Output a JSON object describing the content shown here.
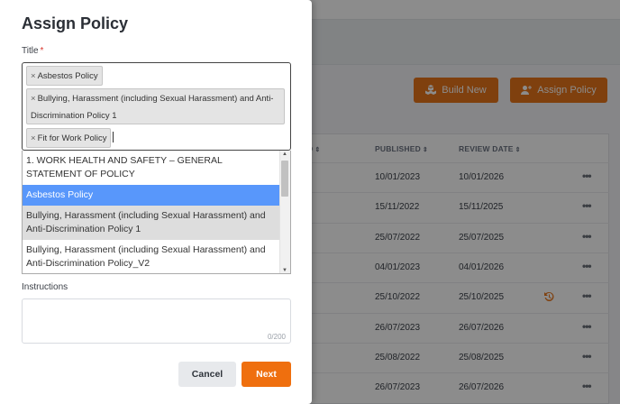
{
  "background": {
    "buttons": {
      "build_new": "Build New",
      "assign_policy": "Assign Policy"
    },
    "table": {
      "headers": {
        "col_partial": "D",
        "published": "PUBLISHED",
        "review_date": "REVIEW DATE"
      },
      "sort_symbol": "⇕",
      "rows": [
        {
          "published": "10/01/2023",
          "review_date": "10/01/2026",
          "history": false
        },
        {
          "published": "15/11/2022",
          "review_date": "15/11/2025",
          "history": false
        },
        {
          "published": "25/07/2022",
          "review_date": "25/07/2025",
          "history": false
        },
        {
          "published": "04/01/2023",
          "review_date": "04/01/2026",
          "history": false
        },
        {
          "published": "25/10/2022",
          "review_date": "25/10/2025",
          "history": true
        },
        {
          "published": "26/07/2023",
          "review_date": "26/07/2026",
          "history": false
        },
        {
          "published": "25/08/2022",
          "review_date": "25/08/2025",
          "history": false
        },
        {
          "published": "26/07/2023",
          "review_date": "26/07/2026",
          "history": false
        }
      ],
      "actions_symbol": "•••"
    }
  },
  "modal": {
    "title": "Assign Policy",
    "title_field": {
      "label": "Title",
      "required_mark": "*",
      "tags": [
        {
          "remove": "×",
          "label": "Asbestos Policy"
        },
        {
          "remove": "×",
          "label": "Bullying, Harassment (including Sexual Harassment) and Anti-Discrimination Policy 1"
        },
        {
          "remove": "×",
          "label": "Fit for Work Policy"
        }
      ]
    },
    "dropdown": {
      "options": [
        {
          "label": "1. WORK HEALTH AND SAFETY – GENERAL STATEMENT OF POLICY",
          "state": "normal"
        },
        {
          "label": "Asbestos Policy",
          "state": "highlighted"
        },
        {
          "label": "Bullying, Harassment (including Sexual Harassment) and Anti-Discrimination Policy 1",
          "state": "selected"
        },
        {
          "label": "Bullying, Harassment (including Sexual Harassment) and Anti-Discrimination Policy_V2",
          "state": "normal"
        }
      ]
    },
    "instructions": {
      "label": "Instructions",
      "value": "",
      "counter": "0/200"
    },
    "buttons": {
      "cancel": "Cancel",
      "next": "Next"
    }
  },
  "colors": {
    "accent": "#ef6f0e",
    "highlight": "#5897fb"
  }
}
